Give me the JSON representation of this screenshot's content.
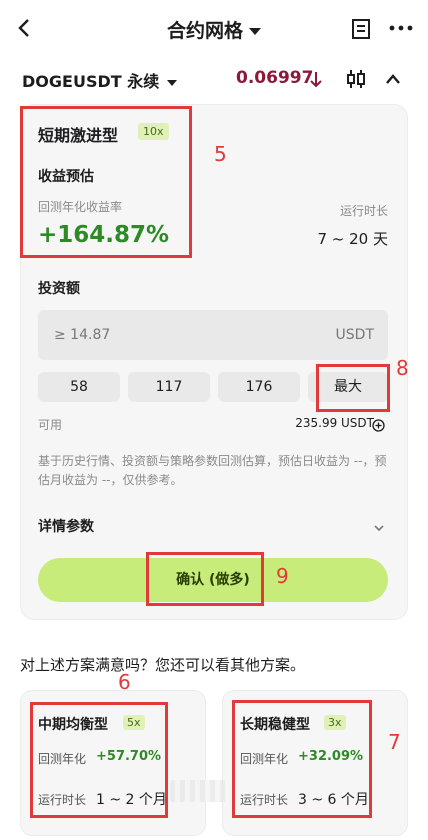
{
  "header": {
    "title": "合约网格",
    "back_icon": "chevron-left-icon",
    "doc_icon": "document-icon",
    "more_icon": "more-dots-icon"
  },
  "ticker": {
    "symbol": "DOGEUSDT 永续",
    "price": "0.06997",
    "price_color": "#8b1a3a",
    "trend_icon": "arrow-down-icon"
  },
  "plan": {
    "name": "短期激进型",
    "leverage": "10x",
    "yield_label": "收益预估",
    "backtest_label": "回测年化收益率",
    "backtest_value": "+164.87%",
    "runtime_label": "运行时长",
    "runtime_value": "7 ~ 20 天"
  },
  "investment": {
    "label": "投资额",
    "placeholder": "≥ 14.87",
    "unit": "USDT",
    "chips": [
      "58",
      "117",
      "176",
      "最大"
    ],
    "available_label": "可用",
    "available_value": "235.99 USDT"
  },
  "note": "基于历史行情、投资额与策略参数回测估算，预估日收益为 --，预估月收益为 --，仅供参考。",
  "details_label": "详情参数",
  "confirm_label": "确认 (做多)",
  "satisfied_text": "对上述方案满意吗？您还可以看其他方案。",
  "alt_plans": [
    {
      "name": "中期均衡型",
      "leverage": "5x",
      "backtest_label": "回测年化",
      "backtest_value": "+57.70%",
      "runtime_label": "运行时长",
      "runtime_value": "1 ~ 2 个月"
    },
    {
      "name": "长期稳健型",
      "leverage": "3x",
      "backtest_label": "回测年化",
      "backtest_value": "+32.09%",
      "runtime_label": "运行时长",
      "runtime_value": "3 ~ 6 个月"
    }
  ],
  "annotations": [
    "5",
    "8",
    "9",
    "6",
    "7"
  ],
  "colors": {
    "accent_green": "#2d8a24",
    "confirm_bg": "#c8ec7a",
    "annotation_red": "#e03a3a"
  }
}
